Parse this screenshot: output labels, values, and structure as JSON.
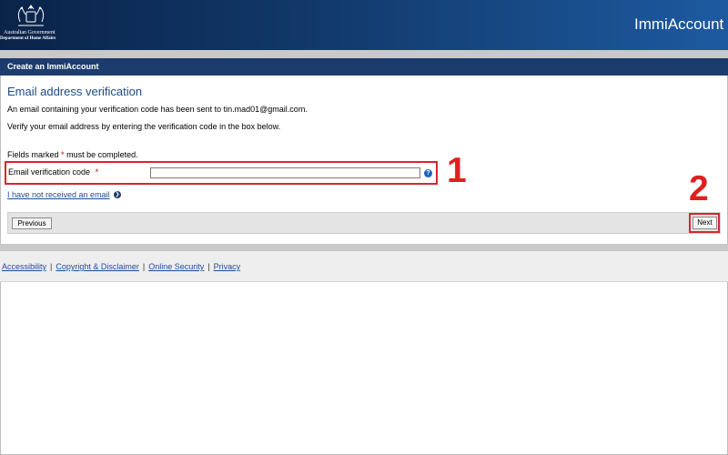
{
  "header": {
    "gov_name": "Australian Government",
    "department": "Department of Home Affairs",
    "brand": "ImmiAccount"
  },
  "title_bar": {
    "label": "Create an ImmiAccount"
  },
  "main": {
    "heading": "Email address verification",
    "sent_message": "An email containing your verification code has been sent to tin.mad01@gmail.com.",
    "instruction": "Verify your email address by entering the verification code in the box below.",
    "required_note_prefix": "Fields marked",
    "required_note_star": "*",
    "required_note_suffix": "must be completed.",
    "field": {
      "label": "Email verification code",
      "star": "*",
      "value": "",
      "placeholder": ""
    },
    "help_icon": "?",
    "not_received_link": "I have not received an email"
  },
  "nav": {
    "previous_label": "Previous",
    "next_label": "Next"
  },
  "annotations": {
    "marker_1": "1",
    "marker_2": "2",
    "marker_color": "#e02020"
  },
  "footer": {
    "links": [
      "Accessibility",
      "Copyright & Disclaimer",
      "Online Security",
      "Privacy"
    ],
    "separator": "|"
  },
  "colors": {
    "header_dark": "#0a2349",
    "header_light": "#1d5aa0",
    "title_bar": "#1c3c6e",
    "heading_text": "#1c4a8a",
    "link": "#1a4f9a",
    "highlight_border": "#d9262c"
  }
}
